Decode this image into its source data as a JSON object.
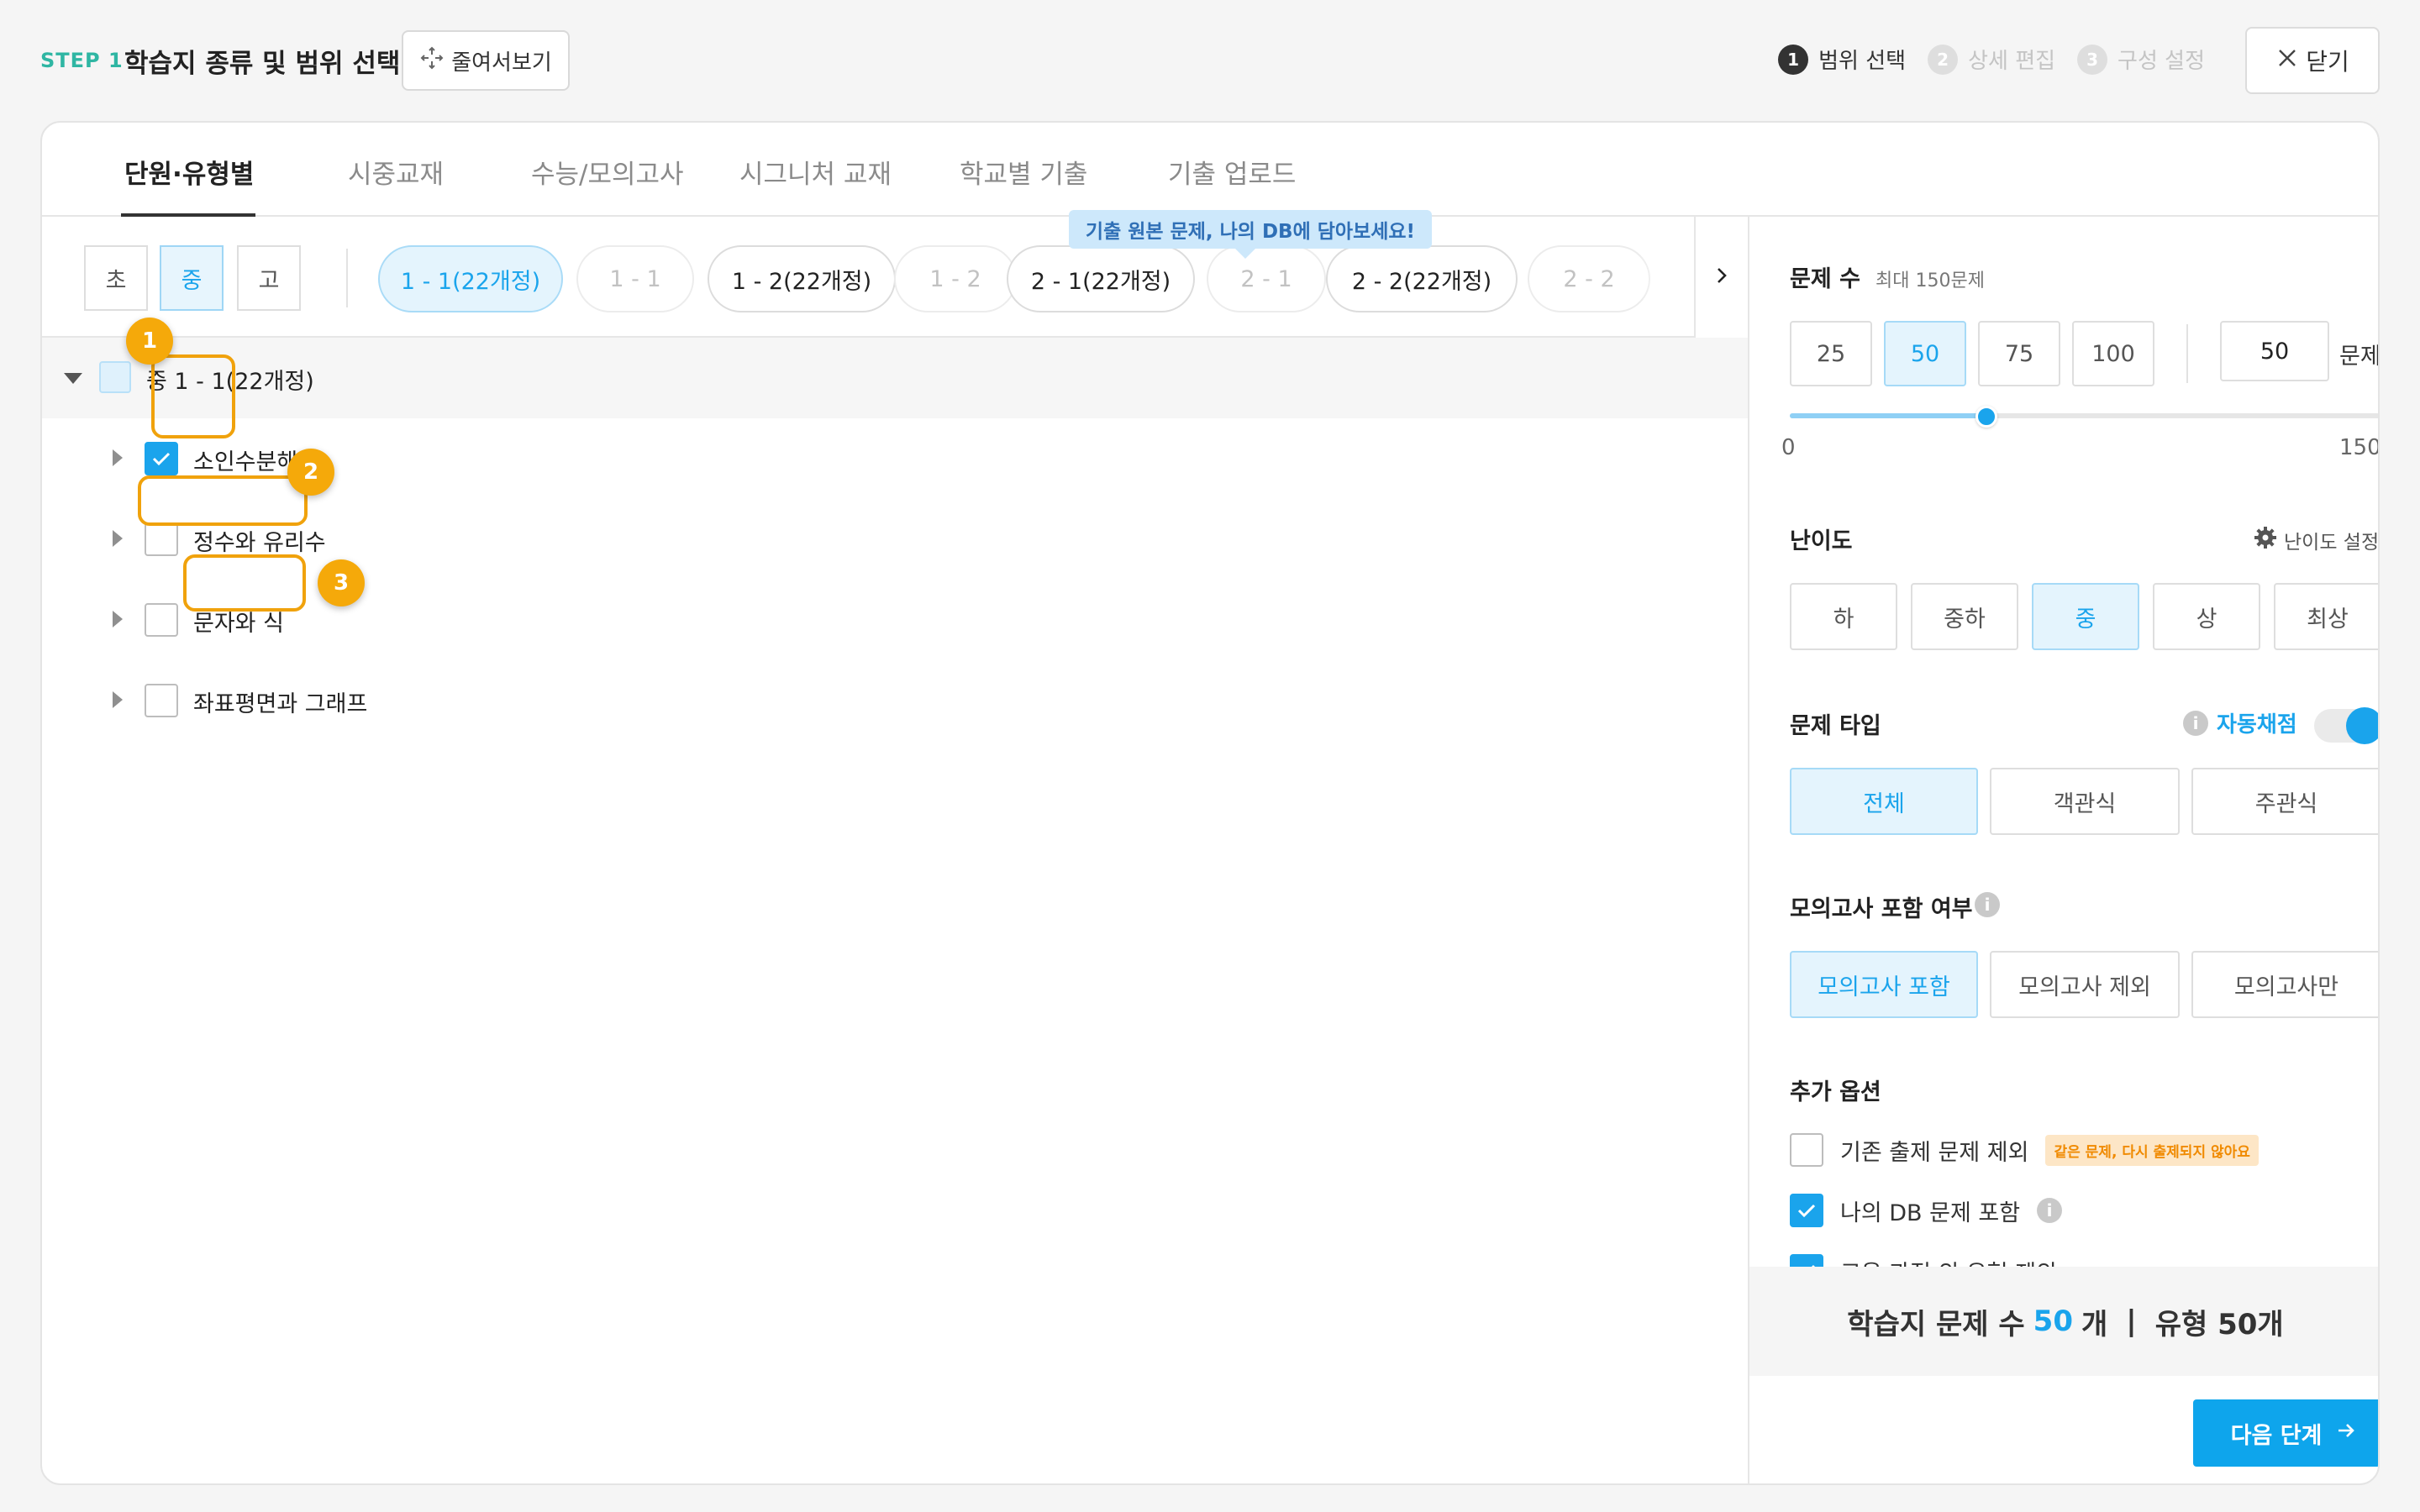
{
  "header": {
    "step_label": "STEP 1",
    "title": "학습지 종류 및 범위 선택",
    "collapse_label": "줄여서보기",
    "close_label": "닫기",
    "steps": [
      {
        "num": "1",
        "label": "범위 선택"
      },
      {
        "num": "2",
        "label": "상세 편집"
      },
      {
        "num": "3",
        "label": "구성 설정"
      }
    ]
  },
  "tabs": [
    "단원·유형별",
    "시중교재",
    "수능/모의고사",
    "시그니처 교재",
    "학교별 기출",
    "기출 업로드"
  ],
  "tooltip": "기출 원본 문제, 나의 DB에 담아보세요!",
  "levels": [
    "초",
    "중",
    "고"
  ],
  "chips": [
    "1 - 1(22개정)",
    "1 - 1",
    "1 - 2(22개정)",
    "1 - 2",
    "2 - 1(22개정)",
    "2 - 1",
    "2 - 2(22개정)",
    "2 - 2"
  ],
  "tree": {
    "root": "중 1 - 1(22개정)",
    "children": [
      "소인수분해",
      "정수와 유리수",
      "문자와 식",
      "좌표평면과 그래프"
    ]
  },
  "annotations": [
    "1",
    "2",
    "3"
  ],
  "settings": {
    "count_title": "문제 수",
    "count_sub": "최대 150문제",
    "count_options": [
      "25",
      "50",
      "75",
      "100"
    ],
    "count_value": "50",
    "count_unit": "문제",
    "slider_min": "0",
    "slider_max": "150",
    "slider_value": 50,
    "difficulty_title": "난이도",
    "difficulty_setting": "난이도 설정",
    "difficulty_options": [
      "하",
      "중하",
      "중",
      "상",
      "최상"
    ],
    "type_title": "문제 타입",
    "auto_grade": "자동채점",
    "type_options": [
      "전체",
      "객관식",
      "주관식"
    ],
    "mock_title": "모의고사 포함 여부",
    "mock_options": [
      "모의고사 포함",
      "모의고사 제외",
      "모의고사만"
    ],
    "extra_title": "추가 옵션",
    "extra_options": [
      {
        "label": "기존 출제 문제 제외",
        "badge": "같은 문제, 다시 출제되지 않아요"
      },
      {
        "label": "나의 DB 문제 포함"
      },
      {
        "label": "교육 과정 외 유형 제외"
      }
    ],
    "info_glyph": "i"
  },
  "summary": {
    "prefix": "학습지 문제 수",
    "count": "50",
    "unit": "개",
    "sep": "|",
    "types": "유형 50개"
  },
  "next_label": "다음 단계",
  "colors": {
    "accent": "#1aa4ec",
    "annotation": "#f5a90a",
    "step_teal": "#2fb6a3"
  }
}
